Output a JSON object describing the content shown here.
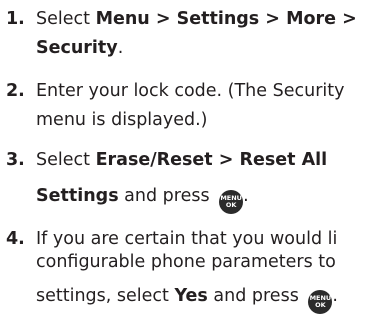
{
  "steps": [
    {
      "number": "1.",
      "line1": {
        "t1": "Select ",
        "b1": "Menu > Settings > More >"
      },
      "line2": {
        "b1": "Security",
        "t1": "."
      }
    },
    {
      "number": "2.",
      "line1": {
        "t1": "Enter your lock code. (The Security"
      },
      "line2": {
        "t1": "menu is displayed.)"
      }
    },
    {
      "number": "3.",
      "line1": {
        "t1": "Select ",
        "b1": "Erase/Reset > Reset All"
      },
      "line2": {
        "b1": "Settings",
        "t1": " and press ",
        "t2": "."
      }
    },
    {
      "number": "4.",
      "line1": {
        "t1": "If you are certain that you would li"
      },
      "line2": {
        "t1": "configurable phone parameters to"
      },
      "line3": {
        "t1": "settings, select ",
        "b1": "Yes",
        "t2": " and press ",
        "t3": "."
      }
    }
  ],
  "menu_ok_key": {
    "top": "MENU",
    "bottom": "OK",
    "icon": "menu-ok-key-icon"
  }
}
